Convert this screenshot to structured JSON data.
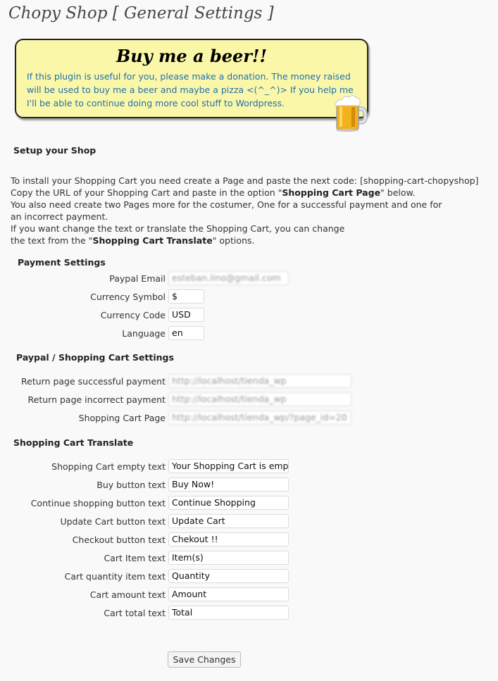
{
  "page": {
    "title": "Chopy Shop [ General Settings ]"
  },
  "donate": {
    "title": "Buy me a beer!!",
    "text": "If this plugin is useful for you, please make a donation. The money raised will be used to buy me a beer and maybe a pizza <(^_^)> If you help me I'll be able to continue doing more cool stuff to Wordpress."
  },
  "setup": {
    "title": "Setup your Shop",
    "line1": "To install your Shopping Cart you need create a Page and paste the next code: [shopping-cart-chopyshop]",
    "line2_pre": "Copy the URL of your Shopping Cart and paste in the option \"",
    "line2_bold": "Shopping Cart Page",
    "line2_post": "\" below.",
    "line3": "You also need create two Pages more for the costumer, One for a successful payment and one for",
    "line4": "an incorrect payment.",
    "line5": "If you want change the text or translate the Shopping Cart, you can change",
    "line6_pre": "the text from the \"",
    "line6_bold": "Shopping Cart Translate",
    "line6_post": "\" options."
  },
  "payment": {
    "title": "Payment Settings",
    "fields": [
      {
        "label": "Paypal Email",
        "value": "esteban.lino@gmail.com"
      },
      {
        "label": "Currency Symbol",
        "value": "$"
      },
      {
        "label": "Currency Code",
        "value": "USD"
      },
      {
        "label": "Language",
        "value": "en"
      }
    ]
  },
  "paypal": {
    "title": "Paypal / Shopping Cart Settings",
    "fields": [
      {
        "label": "Return page successful payment",
        "value": "http://localhost/tienda_wp"
      },
      {
        "label": "Return page incorrect payment",
        "value": "http://localhost/tienda_wp"
      },
      {
        "label": "Shopping Cart Page",
        "value": "http://localhost/tienda_wp/?page_id=20"
      }
    ]
  },
  "translate": {
    "title": "Shopping Cart Translate",
    "fields": [
      {
        "label": "Shopping Cart empty text",
        "value": "Your Shopping Cart is empty"
      },
      {
        "label": "Buy button text",
        "value": "Buy Now!"
      },
      {
        "label": "Continue shopping button text",
        "value": "Continue Shopping"
      },
      {
        "label": "Update Cart button text",
        "value": "Update Cart"
      },
      {
        "label": "Checkout button text",
        "value": "Chekout !!"
      },
      {
        "label": "Cart Item text",
        "value": "Item(s)"
      },
      {
        "label": "Cart quantity item text",
        "value": "Quantity"
      },
      {
        "label": "Cart amount text",
        "value": "Amount"
      },
      {
        "label": "Cart total text",
        "value": "Total"
      }
    ]
  },
  "save": {
    "label": "Save Changes"
  }
}
